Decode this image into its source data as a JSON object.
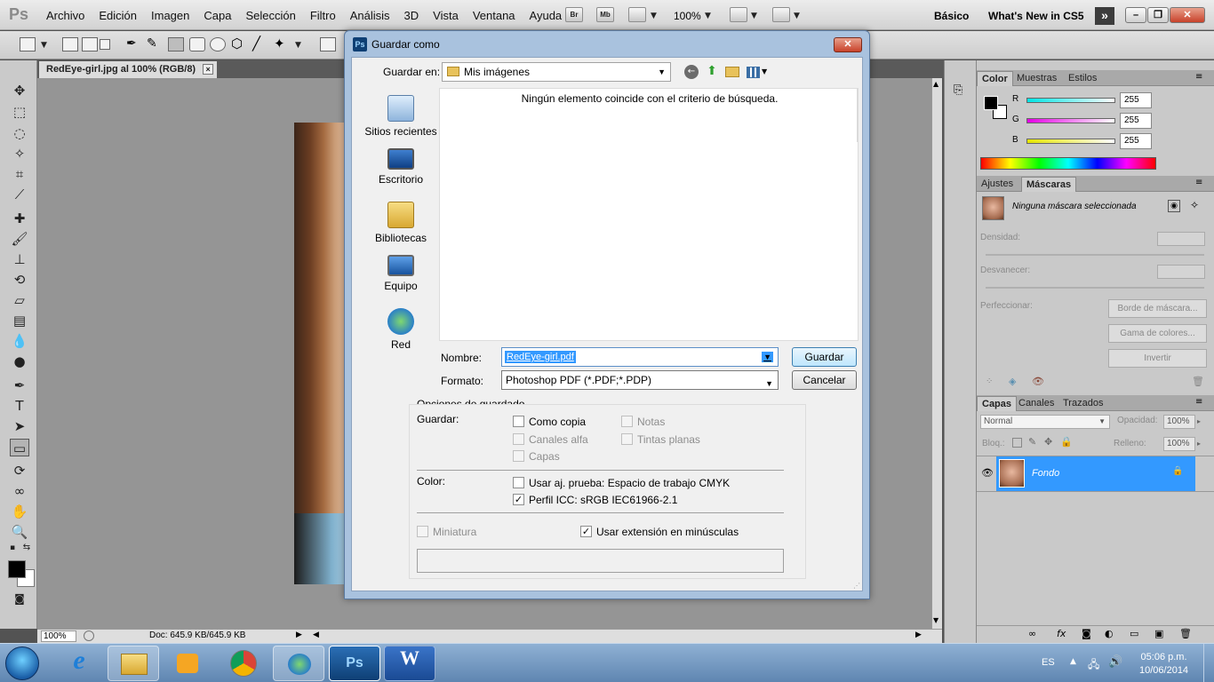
{
  "app": {
    "logo": "Ps",
    "menus": [
      "Archivo",
      "Edición",
      "Imagen",
      "Capa",
      "Selección",
      "Filtro",
      "Análisis",
      "3D",
      "Vista",
      "Ventana",
      "Ayuda"
    ],
    "bridge": "Br",
    "minibridge": "Mb",
    "zoom": "100%",
    "workspace_basic": "Básico",
    "workspace_new": "What's New in CS5",
    "more": "»",
    "minimize": "–",
    "maximize": "❐",
    "close": "✕"
  },
  "document": {
    "tab_title": "RedEye-girl.jpg al 100% (RGB/8)",
    "tab_close": "×",
    "status_zoom": "100%",
    "status_doc": "Doc: 645.9 KB/645.9 KB"
  },
  "panels": {
    "color": {
      "tabs": [
        "Color",
        "Muestras",
        "Estilos"
      ],
      "channels": [
        {
          "label": "R",
          "value": "255",
          "color": "#00e5e5"
        },
        {
          "label": "G",
          "value": "255",
          "color": "#e500e5"
        },
        {
          "label": "B",
          "value": "255",
          "color": "#e5e500"
        }
      ]
    },
    "adjust": {
      "tabs": [
        "Ajustes",
        "Máscaras"
      ],
      "mask_text": "Ninguna máscara seleccionada",
      "density_label": "Densidad:",
      "feather_label": "Desvanecer:",
      "refine_label": "Perfeccionar:",
      "buttons": [
        "Borde de máscara...",
        "Gama de colores...",
        "Invertir"
      ]
    },
    "layers": {
      "tabs": [
        "Capas",
        "Canales",
        "Trazados"
      ],
      "blend_mode": "Normal",
      "opacity_label": "Opacidad:",
      "opacity_value": "100%",
      "lock_label": "Bloq.:",
      "fill_label": "Relleno:",
      "fill_value": "100%",
      "layer_name": "Fondo"
    }
  },
  "dialog": {
    "title": "Guardar como",
    "close": "✕",
    "save_in_label": "Guardar en:",
    "save_in_value": "Mis imágenes",
    "places": [
      "Sitios recientes",
      "Escritorio",
      "Bibliotecas",
      "Equipo",
      "Red"
    ],
    "empty_message": "Ningún elemento coincide con el criterio de búsqueda.",
    "name_label": "Nombre:",
    "name_value": "RedEye-girl.pdf",
    "format_label": "Formato:",
    "format_value": "Photoshop PDF (*.PDF;*.PDP)",
    "save_button": "Guardar",
    "cancel_button": "Cancelar",
    "options_title": "Opciones de guardado",
    "save_label": "Guardar:",
    "opt_as_copy": "Como copia",
    "opt_notes": "Notas",
    "opt_alpha": "Canales alfa",
    "opt_spot": "Tintas planas",
    "opt_layers": "Capas",
    "color_label": "Color:",
    "opt_proof": "Usar aj. prueba: Espacio de trabajo CMYK",
    "opt_icc": "Perfil ICC: sRGB IEC61966-2.1",
    "opt_thumb": "Miniatura",
    "opt_lower": "Usar extensión en minúsculas",
    "check": "✓"
  },
  "taskbar": {
    "apps": [
      "e",
      "Ps",
      "W"
    ],
    "lang": "ES",
    "time": "05:06 p.m.",
    "date": "10/06/2014"
  }
}
